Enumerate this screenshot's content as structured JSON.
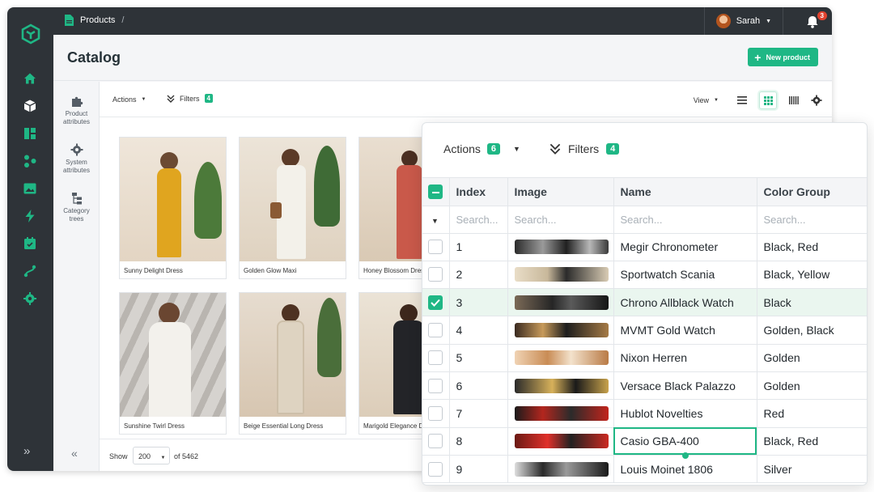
{
  "breadcrumb": {
    "section": "Products",
    "separator": "/"
  },
  "user": {
    "name": "Sarah",
    "notifications": "3"
  },
  "page": {
    "title": "Catalog",
    "new_product_label": "New product"
  },
  "subnav": {
    "items": [
      {
        "label_1": "Product",
        "label_2": "attributes",
        "icon": "puzzle-icon"
      },
      {
        "label_1": "System",
        "label_2": "attributes",
        "icon": "gear-icon"
      },
      {
        "label_1": "Category",
        "label_2": "trees",
        "icon": "tree-icon"
      }
    ]
  },
  "toolbar": {
    "actions_label": "Actions",
    "filters_label": "Filters",
    "filters_count": "4",
    "view_label": "View"
  },
  "cards": [
    {
      "caption": "Sunny Delight Dress",
      "color": "#e0a51f"
    },
    {
      "caption": "Golden Glow Maxi",
      "color": "#ecebe4"
    },
    {
      "caption": "Honey Blossom Dres",
      "color": "#c9594a"
    },
    {
      "caption": "Sunshine Twirl Dress",
      "color": "#f3f1ec"
    },
    {
      "caption": "Beige Essential Long Dress",
      "color": "#ded3c1"
    },
    {
      "caption": "Marigold Elegance D",
      "color": "#232428"
    }
  ],
  "pager": {
    "show_label": "Show",
    "page_size": "200",
    "of_label": "of 5462"
  },
  "panel": {
    "actions_label": "Actions",
    "actions_count": "6",
    "filters_label": "Filters",
    "filters_count": "4",
    "columns": [
      "Index",
      "Image",
      "Name",
      "Color Group"
    ],
    "search_placeholders": [
      "Search...",
      "Search...",
      "Search...",
      "Search..."
    ],
    "rows": [
      {
        "index": "1",
        "name": "Megir Chronometer",
        "color_group": "Black, Red",
        "checked": false
      },
      {
        "index": "2",
        "name": "Sportwatch Scania",
        "color_group": "Black, Yellow",
        "checked": false
      },
      {
        "index": "3",
        "name": "Chrono Allblack Watch",
        "color_group": "Black",
        "checked": true
      },
      {
        "index": "4",
        "name": "MVMT Gold Watch",
        "color_group": "Golden, Black",
        "checked": false
      },
      {
        "index": "5",
        "name": "Nixon Herren",
        "color_group": "Golden",
        "checked": false
      },
      {
        "index": "6",
        "name": "Versace Black Palazzo",
        "color_group": "Golden",
        "checked": false
      },
      {
        "index": "7",
        "name": "Hublot Novelties",
        "color_group": "Red",
        "checked": false
      },
      {
        "index": "8",
        "name": "Casio GBA-400",
        "color_group": "Black, Red",
        "checked": false
      },
      {
        "index": "9",
        "name": "Louis Moinet 1806",
        "color_group": "Silver",
        "checked": false
      }
    ]
  }
}
